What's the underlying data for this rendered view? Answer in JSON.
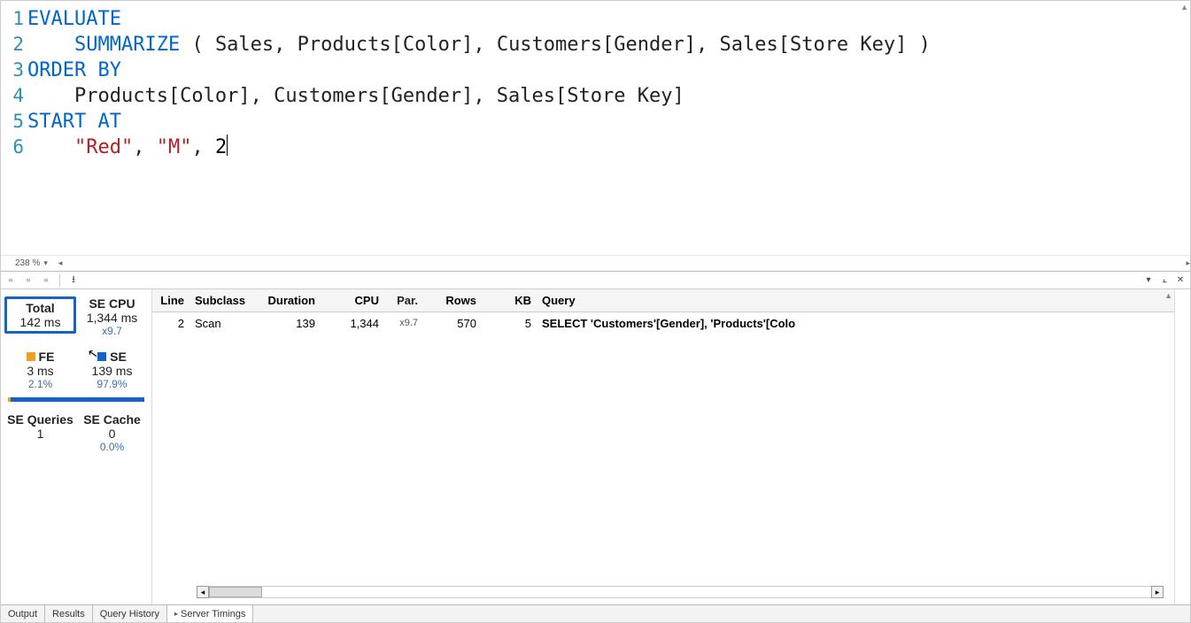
{
  "editor": {
    "zoom": "238 %",
    "lines": [
      {
        "n": "1",
        "tokens": [
          {
            "t": "EVALUATE",
            "c": "kw"
          }
        ]
      },
      {
        "n": "2",
        "tokens": [
          {
            "t": "    ",
            "c": "txt"
          },
          {
            "t": "SUMMARIZE",
            "c": "fn"
          },
          {
            "t": " ( Sales, Products[Color], Customers[Gender], Sales[Store Key] )",
            "c": "txt"
          }
        ]
      },
      {
        "n": "3",
        "tokens": [
          {
            "t": "ORDER BY",
            "c": "kw"
          }
        ]
      },
      {
        "n": "4",
        "tokens": [
          {
            "t": "    Products[Color], Customers[Gender], Sales[Store Key]",
            "c": "txt"
          }
        ]
      },
      {
        "n": "5",
        "tokens": [
          {
            "t": "START AT",
            "c": "kw"
          }
        ]
      },
      {
        "n": "6",
        "tokens": [
          {
            "t": "    ",
            "c": "txt"
          },
          {
            "t": "\"Red\"",
            "c": "str"
          },
          {
            "t": ", ",
            "c": "txt"
          },
          {
            "t": "\"M\"",
            "c": "str"
          },
          {
            "t": ", ",
            "c": "txt"
          },
          {
            "t": "2",
            "c": "num"
          }
        ],
        "cursorAfter": true
      }
    ]
  },
  "stats": {
    "total": {
      "label": "Total",
      "value": "142 ms"
    },
    "secpu": {
      "label": "SE CPU",
      "value": "1,344 ms",
      "sub": "x9.7"
    },
    "fe": {
      "label": "FE",
      "value": "3 ms",
      "sub": "2.1%"
    },
    "se": {
      "label": "SE",
      "value": "139 ms",
      "sub": "97.9%"
    },
    "seq": {
      "label": "SE Queries",
      "value": "1"
    },
    "secache": {
      "label": "SE Cache",
      "value": "0",
      "sub": "0.0%"
    },
    "bar_fe_pct": 2.1,
    "bar_se_pct": 97.9
  },
  "results": {
    "headers": {
      "line": "Line",
      "subclass": "Subclass",
      "duration": "Duration",
      "cpu": "CPU",
      "par": "Par.",
      "rows": "Rows",
      "kb": "KB",
      "query": "Query"
    },
    "rows": [
      {
        "line": "2",
        "subclass": "Scan",
        "duration": "139",
        "cpu": "1,344",
        "par": "x9.7",
        "rows": "570",
        "kb": "5",
        "query": "SELECT 'Customers'[Gender], 'Products'[Colo"
      }
    ]
  },
  "tabs": {
    "output": "Output",
    "results": "Results",
    "history": "Query History",
    "timings": "Server Timings"
  },
  "toolbar": {
    "download_title": "Export"
  }
}
